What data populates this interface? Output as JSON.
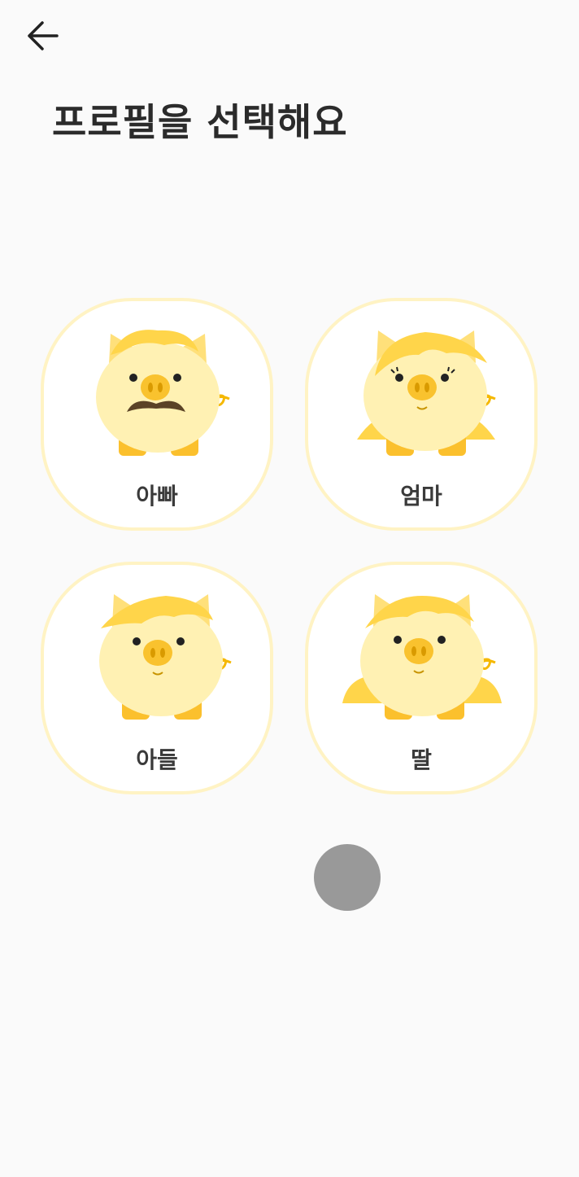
{
  "header": {
    "back_icon": "arrow-left-icon"
  },
  "title": "프로필을 선택해요",
  "profiles": [
    {
      "label": "아빠",
      "icon": "pig-dad-icon"
    },
    {
      "label": "엄마",
      "icon": "pig-mom-icon"
    },
    {
      "label": "아들",
      "icon": "pig-son-icon"
    },
    {
      "label": "딸",
      "icon": "pig-daughter-icon"
    }
  ],
  "colors": {
    "background": "#fafafa",
    "card_border": "#fff3c4",
    "pig_body": "#fff1b3",
    "pig_hair": "#ffd54a",
    "pig_feet": "#fbc02d",
    "fab": "#999999"
  }
}
